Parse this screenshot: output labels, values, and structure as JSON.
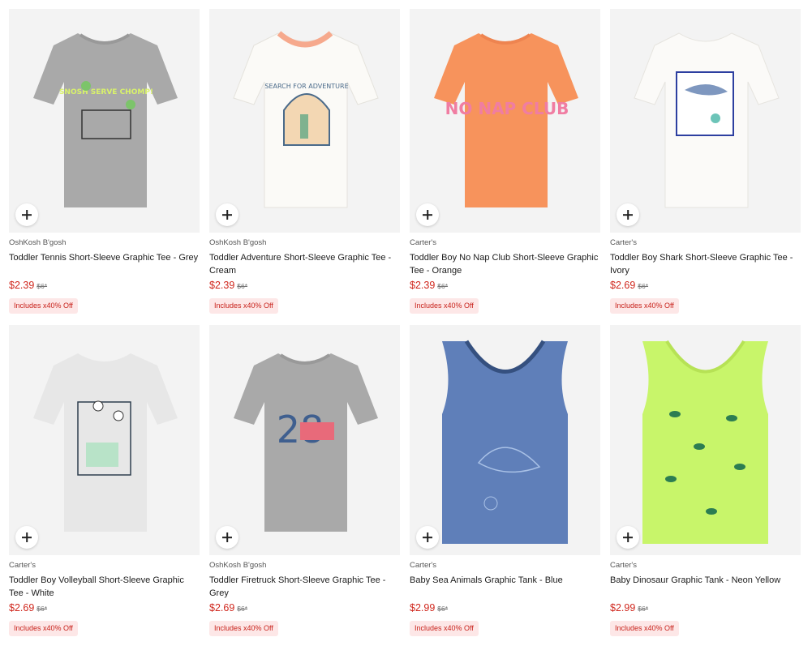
{
  "products": [
    {
      "brand": "OshKosh B'gosh",
      "name": "Toddler Tennis Short-Sleeve Graphic Tee - Grey",
      "price": "$2.39",
      "was": "$6*",
      "badge": "Includes x40% Off",
      "color": "#a9a9a9",
      "art": "SNOSH SERVE CHOMP!",
      "kind": "tee"
    },
    {
      "brand": "OshKosh B'gosh",
      "name": "Toddler Adventure Short-Sleeve Graphic Tee - Cream",
      "price": "$2.39",
      "was": "$6*",
      "badge": "Includes x40% Off",
      "color": "#f6f4ef",
      "art": "SEARCH FOR ADVENTURE",
      "kind": "tee"
    },
    {
      "brand": "Carter's",
      "name": "Toddler Boy No Nap Club Short-Sleeve Graphic Tee - Orange",
      "price": "$2.39",
      "was": "$6*",
      "badge": "Includes x40% Off",
      "color": "#f7935c",
      "art": "NO NAP CLUB",
      "kind": "tee"
    },
    {
      "brand": "Carter's",
      "name": "Toddler Boy Shark Short-Sleeve Graphic Tee - Ivory",
      "price": "$2.69",
      "was": "$6*",
      "badge": "Includes x40% Off",
      "color": "#f7f6f3",
      "art": "",
      "kind": "tee"
    },
    {
      "brand": "Carter's",
      "name": "Toddler Boy Volleyball Short-Sleeve Graphic Tee - White",
      "price": "$2.69",
      "was": "$6*",
      "badge": "Includes x40% Off",
      "color": "#e7e7e7",
      "art": "",
      "kind": "tee"
    },
    {
      "brand": "OshKosh B'gosh",
      "name": "Toddler Firetruck Short-Sleeve Graphic Tee - Grey",
      "price": "$2.69",
      "was": "$6*",
      "badge": "Includes x40% Off",
      "color": "#a9a9a9",
      "art": "28",
      "kind": "tee"
    },
    {
      "brand": "Carter's",
      "name": "Baby Sea Animals Graphic Tank - Blue",
      "price": "$2.99",
      "was": "$6*",
      "badge": "Includes x40% Off",
      "color": "#5f7fb9",
      "art": "",
      "kind": "tank"
    },
    {
      "brand": "Carter's",
      "name": "Baby Dinosaur Graphic Tank - Neon Yellow",
      "price": "$2.99",
      "was": "$6*",
      "badge": "Includes x40% Off",
      "color": "#c8f56a",
      "art": "",
      "kind": "tank"
    }
  ]
}
